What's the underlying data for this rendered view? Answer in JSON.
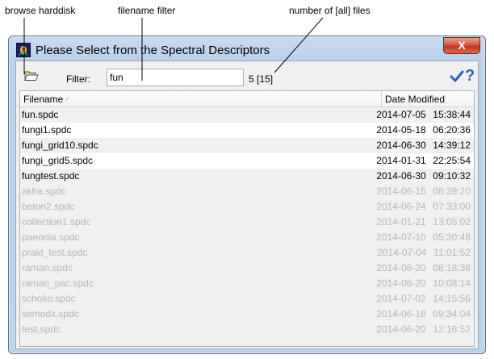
{
  "annotations": {
    "browse": "browse harddisk",
    "filter": "filename filter",
    "count": "number of [all] files"
  },
  "window": {
    "title": "Please Select from the Spectral Descriptors",
    "close_label": "X",
    "app_icon": "app-logo-icon"
  },
  "toolbar": {
    "folder_icon": "open-folder-icon",
    "filter_label": "Filter:",
    "filter_value": "fun",
    "count": "5 [15]",
    "ok_icon": "checkmark-icon",
    "help_label": "?"
  },
  "table": {
    "columns": {
      "filename": "Filename",
      "date": "Date Modified"
    },
    "sorted_by": "Filename",
    "rows": [
      {
        "name": "fun.spdc",
        "date": "2014-07-05",
        "time": "15:38:44",
        "match": true
      },
      {
        "name": "fungi1.spdc",
        "date": "2014-05-18",
        "time": "06:20:36",
        "match": true
      },
      {
        "name": "fungi_grid10.spdc",
        "date": "2014-06-30",
        "time": "14:39:12",
        "match": true
      },
      {
        "name": "fungi_grid5.spdc",
        "date": "2014-01-31",
        "time": "22:25:54",
        "match": true
      },
      {
        "name": "fungtest.spdc",
        "date": "2014-06-30",
        "time": "09:10:32",
        "match": true
      },
      {
        "name": "akha.spdc",
        "date": "2014-06-15",
        "time": "08:39:20",
        "match": false
      },
      {
        "name": "beton2.spdc",
        "date": "2014-06-24",
        "time": "07:33:00",
        "match": false
      },
      {
        "name": "collection1.spdc",
        "date": "2014-01-21",
        "time": "13:05:02",
        "match": false
      },
      {
        "name": "paeonia.spdc",
        "date": "2014-07-10",
        "time": "05:30:48",
        "match": false
      },
      {
        "name": "prakt_test.spdc",
        "date": "2014-07-04",
        "time": "11:01:52",
        "match": false
      },
      {
        "name": "raman.spdc",
        "date": "2014-06-20",
        "time": "08:18:36",
        "match": false
      },
      {
        "name": "raman_pac.spdc",
        "date": "2014-06-20",
        "time": "10:08:14",
        "match": false
      },
      {
        "name": "schoko.spdc",
        "date": "2014-07-02",
        "time": "14:15:56",
        "match": false
      },
      {
        "name": "semedx.spdc",
        "date": "2014-06-18",
        "time": "09:34:04",
        "match": false
      },
      {
        "name": "test.spdc",
        "date": "2014-06-20",
        "time": "12:16:52",
        "match": false
      }
    ]
  },
  "colors": {
    "match_text": "#000000",
    "dim_text": "#b7b7b7",
    "accent": "#2a63b8",
    "close_button": "#c2351c"
  }
}
